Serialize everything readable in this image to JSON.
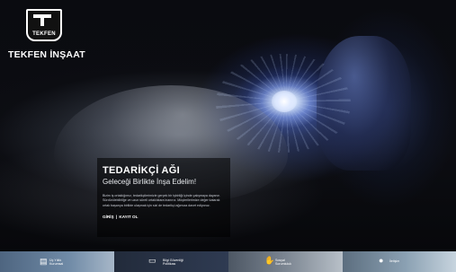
{
  "brand": {
    "emblem_text": "TEKFEN",
    "company_name": "TEKFEN İNŞAAT"
  },
  "hero": {
    "title": "TEDARİKÇİ AĞI",
    "subtitle": "Geleceği Birlikte İnşa Edelim!",
    "body": "Bizim iş ortaklığımız, tedarikçilerimizle gerçek bir işbirliği içinde çalışmaya dayanır. Sürdürülebilirliğe ve uzun süreli ortaklıklara inanırız. Müşterilerimize değer katarak ortak başarıya birlikte ulaşmak için sizi de tedarikçi ağımıza davet ediyoruz.",
    "login_label": "GİRİŞ",
    "separator": "|",
    "register_label": "KAYIT OL"
  },
  "tiles": [
    {
      "label": "Üç Yıllık\nKurumsal",
      "icon": "document-icon"
    },
    {
      "label": "Bilgi Güvenliği\nPolitikası",
      "icon": "monitor-icon"
    },
    {
      "label": "Sosyal\nSorumluluk",
      "icon": "hand-icon"
    },
    {
      "label": "İletişim",
      "icon": "person-icon"
    }
  ],
  "colors": {
    "panel_bg": "rgba(0,0,0,0.55)",
    "text": "#ffffff"
  }
}
